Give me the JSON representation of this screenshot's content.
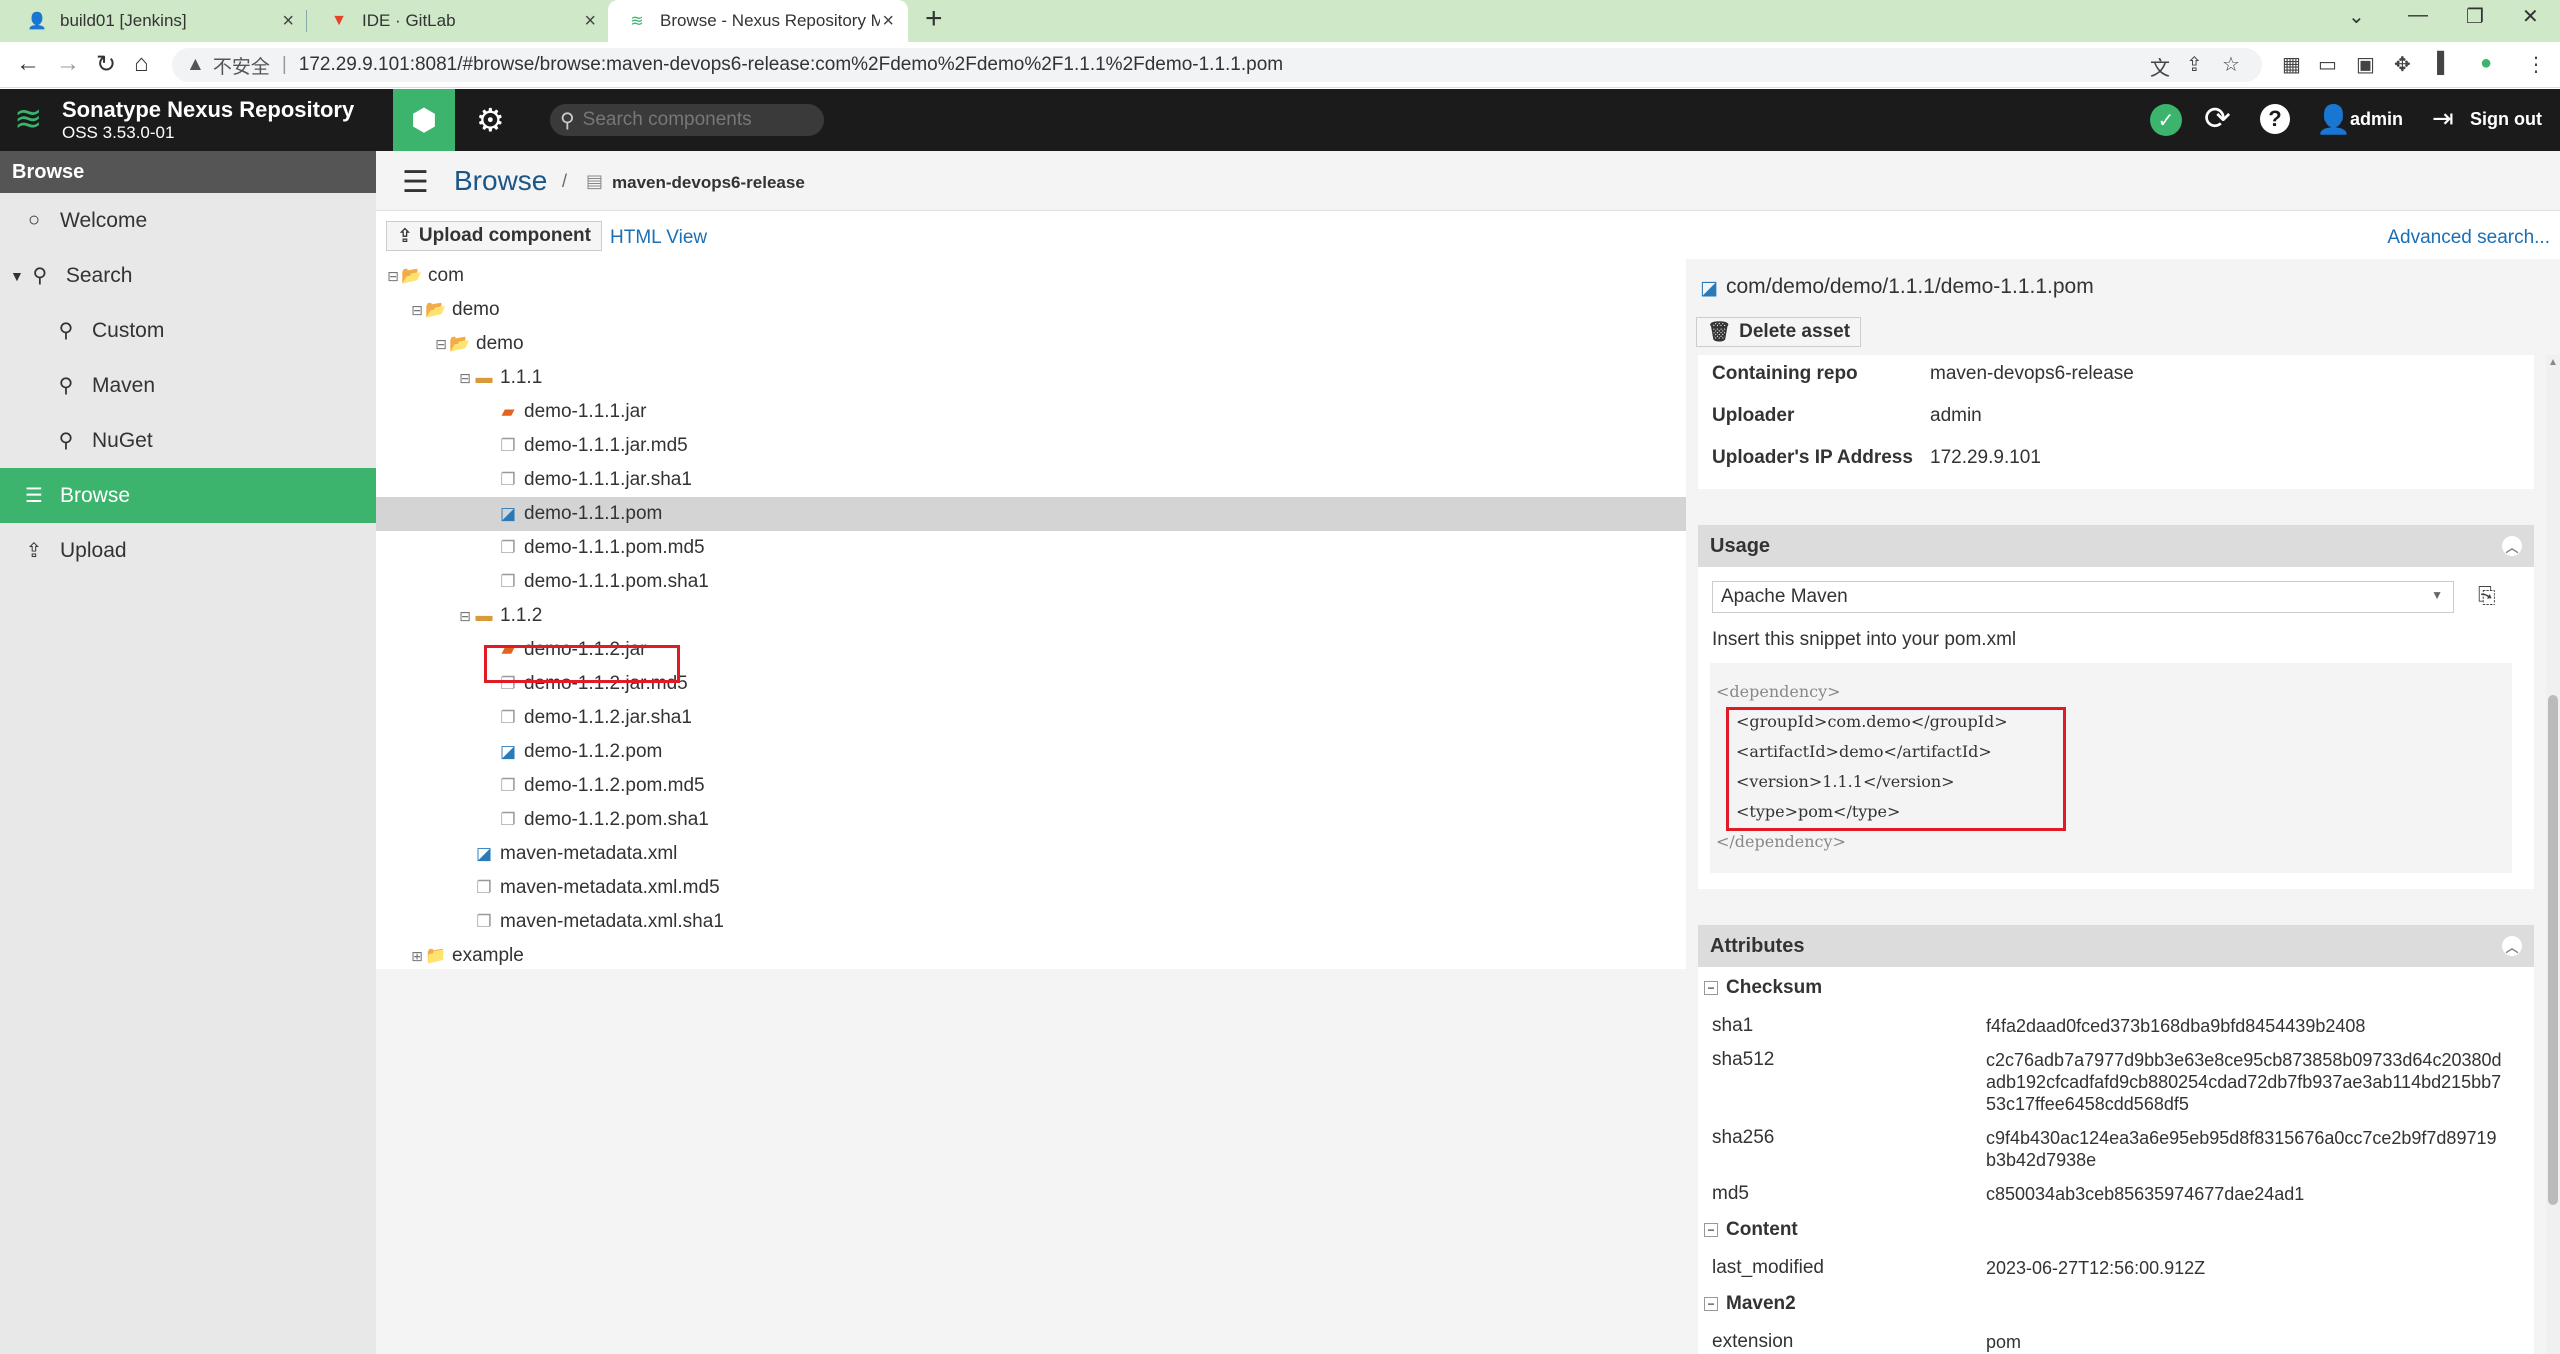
{
  "browser": {
    "tabs": [
      {
        "title": "build01 [Jenkins]"
      },
      {
        "title": "IDE · GitLab"
      },
      {
        "title": "Browse - Nexus Repository M"
      }
    ],
    "address": {
      "insecure_label": "不安全",
      "url": "172.29.9.101:8081/#browse/browse:maven-devops6-release:com%2Fdemo%2Fdemo%2F1.1.1%2Fdemo-1.1.1.pom"
    }
  },
  "header": {
    "product": "Sonatype Nexus Repository",
    "version": "OSS 3.53.0-01",
    "search_placeholder": "Search components",
    "username": "admin",
    "signout": "Sign out"
  },
  "sidebar": {
    "section": "Browse",
    "items": [
      {
        "label": "Welcome"
      },
      {
        "label": "Search"
      },
      {
        "label": "Custom"
      },
      {
        "label": "Maven"
      },
      {
        "label": "NuGet"
      },
      {
        "label": "Browse"
      },
      {
        "label": "Upload"
      }
    ]
  },
  "breadcrumb": {
    "title": "Browse",
    "repo": "maven-devops6-release"
  },
  "toolbar": {
    "upload": "Upload component",
    "html_view": "HTML View",
    "advanced_search": "Advanced search..."
  },
  "tree": [
    {
      "label": "com"
    },
    {
      "label": "demo"
    },
    {
      "label": "demo"
    },
    {
      "label": "1.1.1"
    },
    {
      "label": "demo-1.1.1.jar"
    },
    {
      "label": "demo-1.1.1.jar.md5"
    },
    {
      "label": "demo-1.1.1.jar.sha1"
    },
    {
      "label": "demo-1.1.1.pom"
    },
    {
      "label": "demo-1.1.1.pom.md5"
    },
    {
      "label": "demo-1.1.1.pom.sha1"
    },
    {
      "label": "1.1.2"
    },
    {
      "label": "demo-1.1.2.jar"
    },
    {
      "label": "demo-1.1.2.jar.md5"
    },
    {
      "label": "demo-1.1.2.jar.sha1"
    },
    {
      "label": "demo-1.1.2.pom"
    },
    {
      "label": "demo-1.1.2.pom.md5"
    },
    {
      "label": "demo-1.1.2.pom.sha1"
    },
    {
      "label": "maven-metadata.xml"
    },
    {
      "label": "maven-metadata.xml.md5"
    },
    {
      "label": "maven-metadata.xml.sha1"
    },
    {
      "label": "example"
    }
  ],
  "detail": {
    "path": "com/demo/demo/1.1.1/demo-1.1.1.pom",
    "delete": "Delete asset",
    "summary": [
      {
        "key": "Containing repo",
        "value": "maven-devops6-release"
      },
      {
        "key": "Uploader",
        "value": "admin"
      },
      {
        "key": "Uploader's IP Address",
        "value": "172.29.9.101"
      }
    ],
    "usage": {
      "title": "Usage",
      "format": "Apache Maven",
      "hint": "Insert this snippet into your pom.xml",
      "snippet": [
        "<dependency>",
        "<groupId>com.demo</groupId>",
        "<artifactId>demo</artifactId>",
        "<version>1.1.1</version>",
        "<type>pom</type>",
        "</dependency>"
      ]
    },
    "attributes": {
      "title": "Attributes",
      "checksum_title": "Checksum",
      "sha1_key": "sha1",
      "sha1": "f4fa2daad0fced373b168dba9bfd8454439b2408",
      "sha512_key": "sha512",
      "sha512": "c2c76adb7a7977d9bb3e63e8ce95cb873858b09733d64c20380dadb192cfcadfafd9cb880254cdad72db7fb937ae3ab114bd215bb753c17ffee6458cdd568df5",
      "sha256_key": "sha256",
      "sha256": "c9f4b430ac124ea3a6e95eb95d8f8315676a0cc7ce2b9f7d89719b3b42d7938e",
      "md5_key": "md5",
      "md5": "c850034ab3ceb85635974677dae24ad1",
      "content_title": "Content",
      "last_modified_key": "last_modified",
      "last_modified": "2023-06-27T12:56:00.912Z",
      "maven2_title": "Maven2",
      "extension_key": "extension",
      "extension": "pom"
    }
  }
}
